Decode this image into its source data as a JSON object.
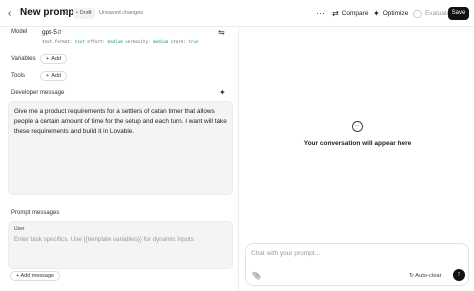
{
  "header": {
    "back_icon": "chevron-left-icon",
    "title": "New prompt",
    "draft_badge": "Draft",
    "unsaved": "Unsaved changes",
    "more_label": "···",
    "compare_label": "Compare",
    "optimize_label": "Optimize",
    "evaluate_label": "Evaluate",
    "save_label": "Save"
  },
  "model": {
    "label": "Model",
    "name": "gpt-5",
    "params": [
      {
        "key": "text.format:",
        "value": "text"
      },
      {
        "key": "effort:",
        "value": "medium"
      },
      {
        "key": "verbosity:",
        "value": "medium"
      },
      {
        "key": "store:",
        "value": "true"
      }
    ]
  },
  "variables": {
    "label": "Variables",
    "add_label": "Add"
  },
  "tools": {
    "label": "Tools",
    "add_label": "Add"
  },
  "developer": {
    "label": "Developer message",
    "text": "Give me a product requirements for a settlers of catan timer that allows people a certain amount of time for the setup and each turn. I want will take these requirements and build it in Lovable."
  },
  "prompt_messages": {
    "label": "Prompt messages",
    "user_label": "User",
    "placeholder": "Enter task specifics. Use {{template variables}} for dynamic inputs",
    "add_message_label": "Add message"
  },
  "chat": {
    "empty_message": "Your conversation will appear here",
    "input_placeholder": "Chat with your prompt...",
    "autoclear_label": "Auto-clear"
  }
}
